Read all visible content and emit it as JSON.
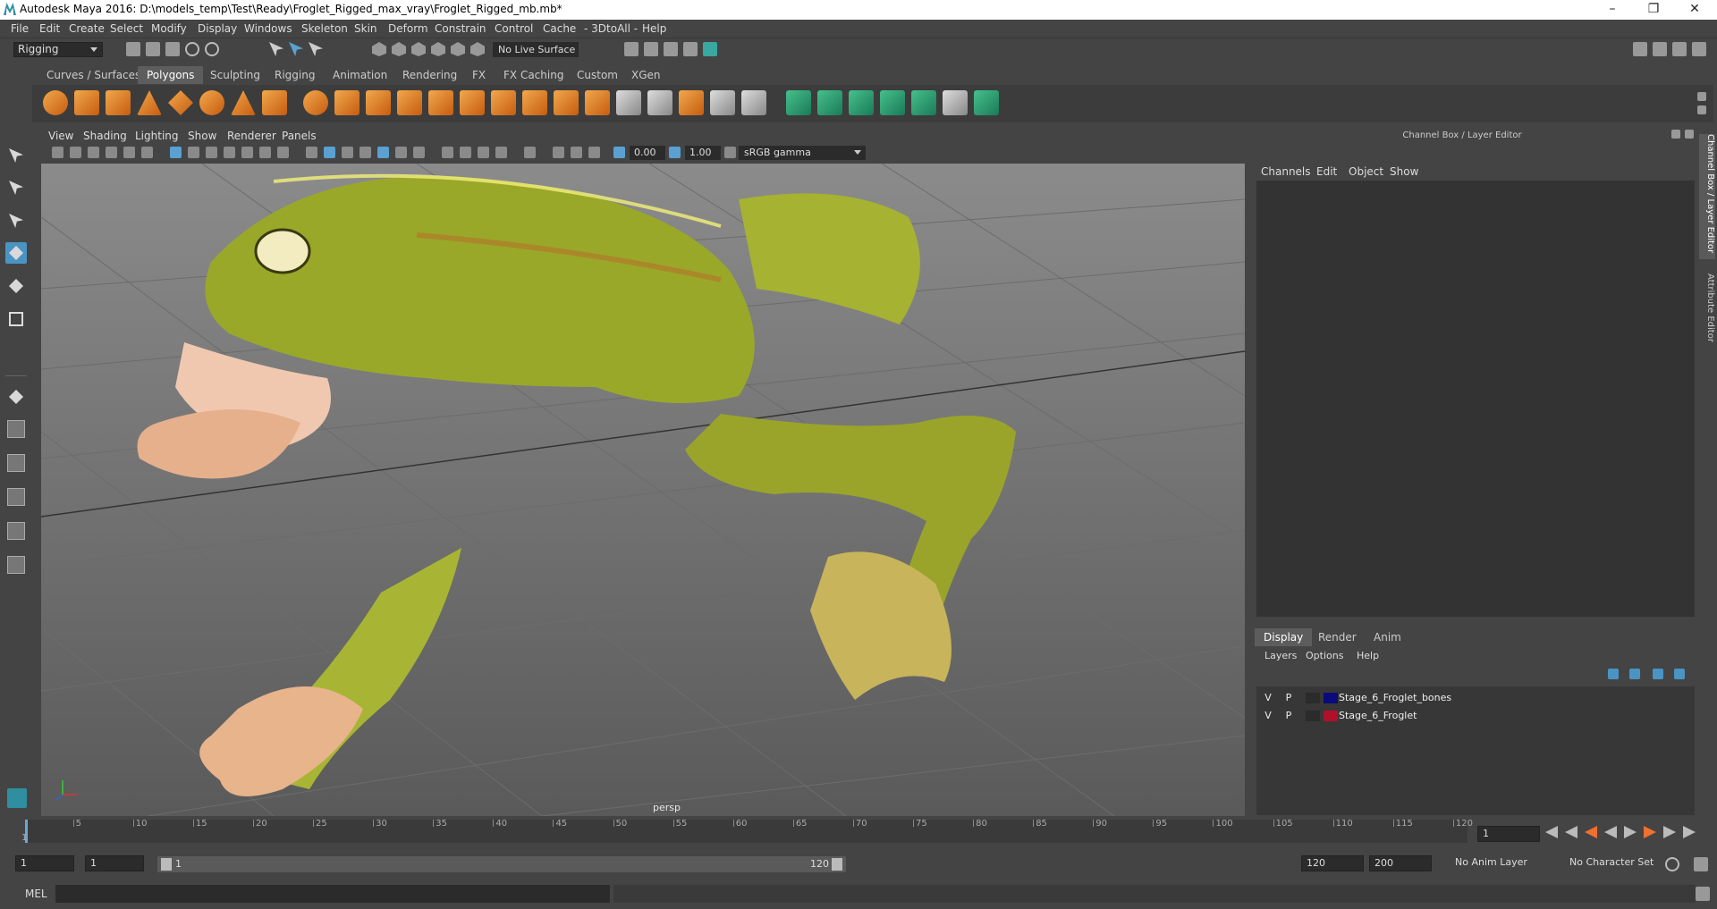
{
  "window": {
    "title": "Autodesk Maya 2016: D:\\models_temp\\Test\\Ready\\Froglet_Rigged_max_vray\\Froglet_Rigged_mb.mb*"
  },
  "menus": [
    "File",
    "Edit",
    "Create",
    "Select",
    "Modify",
    "Display",
    "Windows",
    "Skeleton",
    "Skin",
    "Deform",
    "Constrain",
    "Control",
    "Cache",
    "- 3DtoAll -",
    "Help"
  ],
  "status": {
    "mode": "Rigging",
    "live_surface": "No Live Surface"
  },
  "shelf_tabs": [
    "Curves / Surfaces",
    "Polygons",
    "Sculpting",
    "Rigging",
    "Animation",
    "Rendering",
    "FX",
    "FX Caching",
    "Custom",
    "XGen"
  ],
  "shelf_active": "Polygons",
  "viewport": {
    "menus": [
      "View",
      "Shading",
      "Lighting",
      "Show",
      "Renderer",
      "Panels"
    ],
    "exposure": "0.00",
    "gamma_value": "1.00",
    "color_space": "sRGB gamma",
    "camera": "persp"
  },
  "channel_box": {
    "title": "Channel Box / Layer Editor",
    "menus": [
      "Channels",
      "Edit",
      "Object",
      "Show"
    ]
  },
  "layer_editor": {
    "tabs": [
      "Display",
      "Render",
      "Anim"
    ],
    "active_tab": "Display",
    "menus": [
      "Layers",
      "Options",
      "Help"
    ],
    "layers": [
      {
        "visible": "V",
        "playback": "P",
        "name": "Stage_6_Froglet_bones",
        "color": "#0a0a7a"
      },
      {
        "visible": "V",
        "playback": "P",
        "name": "Stage_6_Froglet",
        "color": "#b0102a"
      }
    ]
  },
  "side_tabs": [
    "Channel Box / Layer Editor",
    "Attribute Editor"
  ],
  "timeline": {
    "ticks": [
      "5",
      "10",
      "15",
      "20",
      "25",
      "30",
      "35",
      "40",
      "45",
      "50",
      "55",
      "60",
      "65",
      "70",
      "75",
      "80",
      "85",
      "90",
      "95",
      "100",
      "105",
      "110",
      "115",
      "120"
    ],
    "start_label": "1",
    "current_frame": "1"
  },
  "range": {
    "start": "1",
    "playback_start": "1",
    "slider_start": "1",
    "slider_end": "120",
    "playback_end": "120",
    "end": "200",
    "anim_layer": "No Anim Layer",
    "character_set": "No Character Set"
  },
  "command_line": {
    "label": "MEL"
  },
  "colors": {
    "accent": "#4a94c4",
    "frog_body": "#9aa82a",
    "frog_skin": "#e6b38e"
  }
}
